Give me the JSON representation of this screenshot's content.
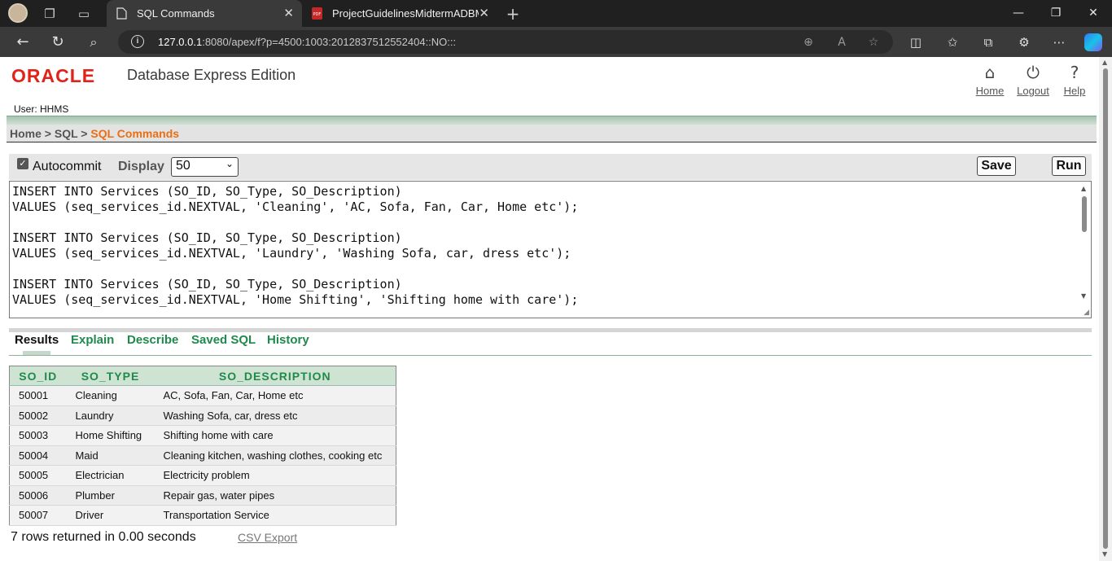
{
  "browser": {
    "tabs": [
      {
        "title": "SQL Commands",
        "active": true,
        "favicon": "document-icon"
      },
      {
        "title": "ProjectGuidelinesMidtermADBMS",
        "active": false,
        "favicon": "pdf-icon"
      }
    ],
    "url_host": "127.0.0.1",
    "url_rest": ":8080/apex/f?p=4500:1003:2012837512552404::NO:::",
    "new_tab_symbol": "+",
    "close_symbol": "✕"
  },
  "header": {
    "logo_text": "ORACLE",
    "edition_title": "Database Express Edition",
    "user_label": "User: HHMS",
    "links": [
      {
        "label": "Home",
        "icon": "home-icon"
      },
      {
        "label": "Logout",
        "icon": "power-icon"
      },
      {
        "label": "Help",
        "icon": "question-icon"
      }
    ]
  },
  "breadcrumb": {
    "home": "Home",
    "sep1": " > ",
    "sql": "SQL",
    "sep2": " > ",
    "current": "SQL Commands"
  },
  "toolbar": {
    "autocommit_label": "Autocommit",
    "autocommit_checked": true,
    "display_label": "Display",
    "display_value": "50",
    "save_label": "Save",
    "run_label": "Run"
  },
  "editor": {
    "text": "INSERT INTO Services (SO_ID, SO_Type, SO_Description)\nVALUES (seq_services_id.NEXTVAL, 'Cleaning', 'AC, Sofa, Fan, Car, Home etc');\n\nINSERT INTO Services (SO_ID, SO_Type, SO_Description)\nVALUES (seq_services_id.NEXTVAL, 'Laundry', 'Washing Sofa, car, dress etc');\n\nINSERT INTO Services (SO_ID, SO_Type, SO_Description)\nVALUES (seq_services_id.NEXTVAL, 'Home Shifting', 'Shifting home with care');"
  },
  "result_tabs": [
    "Results",
    "Explain",
    "Describe",
    "Saved SQL",
    "History"
  ],
  "results": {
    "columns": [
      "SO_ID",
      "SO_TYPE",
      "SO_DESCRIPTION"
    ],
    "rows": [
      [
        "50001",
        "Cleaning",
        "AC, Sofa, Fan, Car, Home etc"
      ],
      [
        "50002",
        "Laundry",
        "Washing Sofa, car, dress etc"
      ],
      [
        "50003",
        "Home Shifting",
        "Shifting home with care"
      ],
      [
        "50004",
        "Maid",
        "Cleaning kitchen, washing clothes, cooking etc"
      ],
      [
        "50005",
        "Electrician",
        "Electricity problem"
      ],
      [
        "50006",
        "Plumber",
        "Repair gas, water pipes"
      ],
      [
        "50007",
        "Driver",
        "Transportation Service"
      ]
    ],
    "summary": "7 rows returned in 0.00 seconds",
    "csv_export": "CSV Export"
  },
  "colors": {
    "oracle_red": "#e2231a",
    "breadcrumb_current": "#ea6e12",
    "tab_green": "#1f8a4c",
    "header_green": "#cfe3d3"
  }
}
